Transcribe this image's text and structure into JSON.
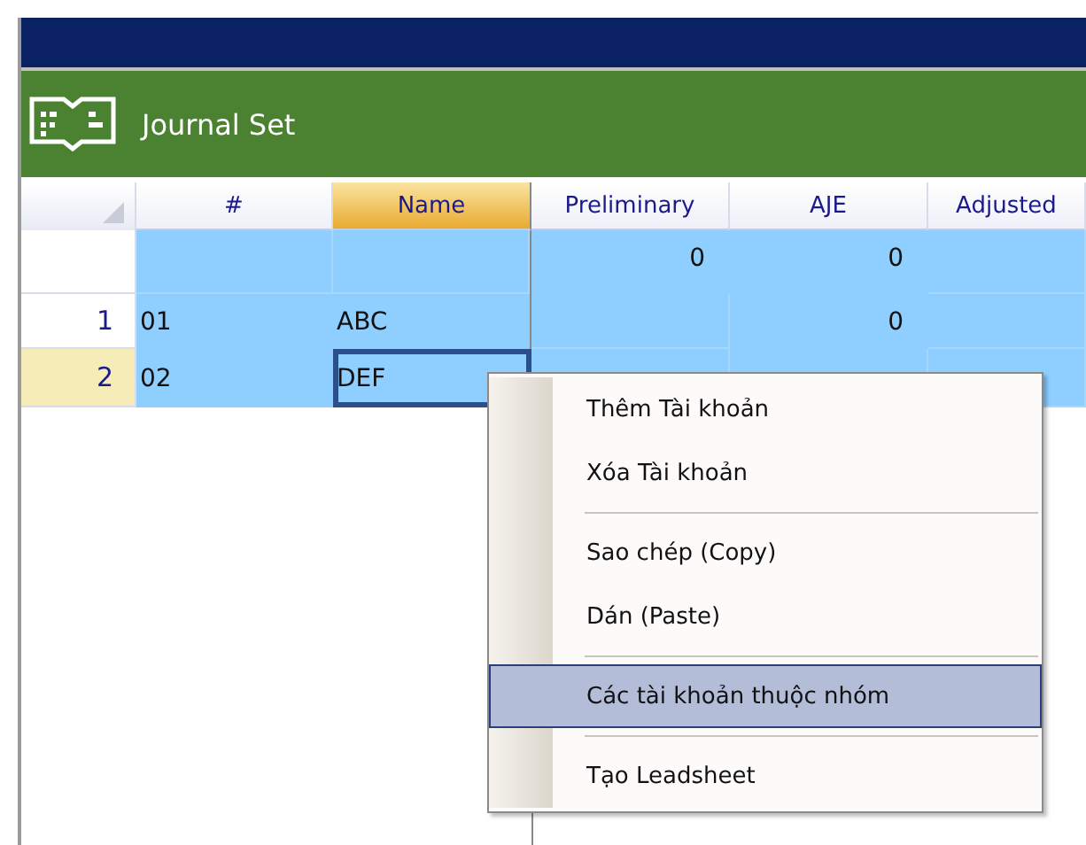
{
  "panel": {
    "title": "Journal Set"
  },
  "grid": {
    "columns": [
      {
        "label": "#",
        "selected": false
      },
      {
        "label": "Name",
        "selected": true
      },
      {
        "label": "Preliminary",
        "selected": false
      },
      {
        "label": "AJE",
        "selected": false
      },
      {
        "label": "Adjusted",
        "selected": false
      }
    ],
    "rows": [
      {
        "current": false,
        "cells": {
          "preliminary": "0",
          "aje": "0"
        }
      },
      {
        "header": "1",
        "current": false,
        "cells": {
          "number": "01",
          "name": "ABC",
          "aje": "0"
        }
      },
      {
        "header": "2",
        "current": true,
        "focused_name": true,
        "cells": {
          "number": "02",
          "name": "DEF"
        }
      }
    ]
  },
  "context_menu": [
    {
      "kind": "item",
      "label": "Thêm Tài khoản",
      "selected": false
    },
    {
      "kind": "item",
      "label": "Xóa Tài khoản",
      "selected": false
    },
    {
      "kind": "separator"
    },
    {
      "kind": "item",
      "label": "Sao chép (Copy)",
      "selected": false
    },
    {
      "kind": "item",
      "label": "Dán (Paste)",
      "selected": false
    },
    {
      "kind": "separator"
    },
    {
      "kind": "item",
      "label": "Các tài khoản thuộc nhóm",
      "selected": true
    },
    {
      "kind": "separator"
    },
    {
      "kind": "item",
      "label": "Tạo Leadsheet",
      "selected": false
    }
  ]
}
